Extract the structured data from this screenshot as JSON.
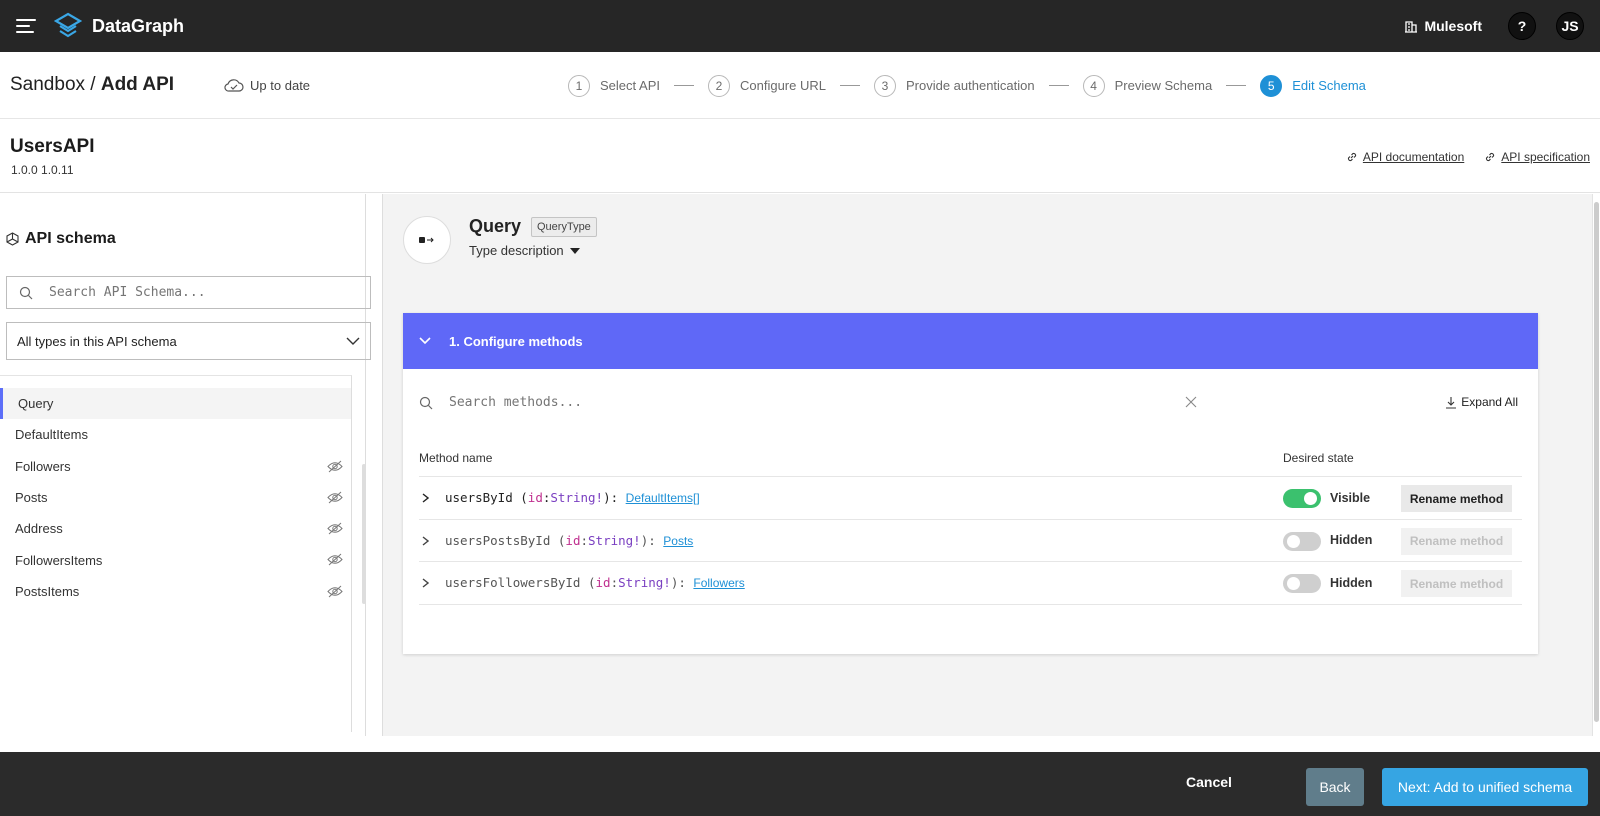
{
  "topbar": {
    "brand": "DataGraph",
    "org": "Mulesoft",
    "help": "?",
    "avatar": "JS"
  },
  "stepbar": {
    "crumb_parent": "Sandbox /",
    "crumb_current": "Add API",
    "sync_status": "Up to date",
    "steps": [
      {
        "num": "1",
        "label": "Select API"
      },
      {
        "num": "2",
        "label": "Configure URL"
      },
      {
        "num": "3",
        "label": "Provide authentication"
      },
      {
        "num": "4",
        "label": "Preview Schema"
      },
      {
        "num": "5",
        "label": "Edit Schema"
      }
    ]
  },
  "api": {
    "name": "UsersAPI",
    "version": "1.0.0 1.0.11",
    "doc_link": "API documentation",
    "spec_link": "API specification"
  },
  "sidebar": {
    "title": "API schema",
    "search_placeholder": "Search API Schema...",
    "filter_selected": "All types in this API schema",
    "items": [
      {
        "label": "Query"
      },
      {
        "label": "DefaultItems"
      },
      {
        "label": "Followers"
      },
      {
        "label": "Posts"
      },
      {
        "label": "Address"
      },
      {
        "label": "FollowersItems"
      },
      {
        "label": "PostsItems"
      }
    ]
  },
  "main": {
    "type_name": "Query",
    "type_badge": "QueryType",
    "type_description": "Type description",
    "panel_title": "1. Configure methods",
    "search_placeholder": "Search methods...",
    "expand_all": "Expand All",
    "col_method": "Method name",
    "col_state": "Desired state",
    "methods": [
      {
        "name": "usersById",
        "open": " (",
        "arg": "id",
        "colon": ":",
        "type": "String!",
        "close": "): ",
        "return": "DefaultItems[]",
        "state": "Visible",
        "rename": "Rename method"
      },
      {
        "name": "usersPostsById",
        "open": " (",
        "arg": "id",
        "colon": ":",
        "type": "String!",
        "close": "): ",
        "return": "Posts",
        "state": "Hidden",
        "rename": "Rename method"
      },
      {
        "name": "usersFollowersById",
        "open": " (",
        "arg": "id",
        "colon": ":",
        "type": "String!",
        "close": "): ",
        "return": "Followers",
        "state": "Hidden",
        "rename": "Rename method"
      }
    ]
  },
  "footer": {
    "cancel": "Cancel",
    "back": "Back",
    "next": "Next: Add to unified schema"
  },
  "colors": {
    "accent": "#5f68f7",
    "active_step": "#1e90d6",
    "toggle_on": "#3bc16e",
    "next_button": "#36a5e3",
    "back_button": "#607d8b"
  }
}
